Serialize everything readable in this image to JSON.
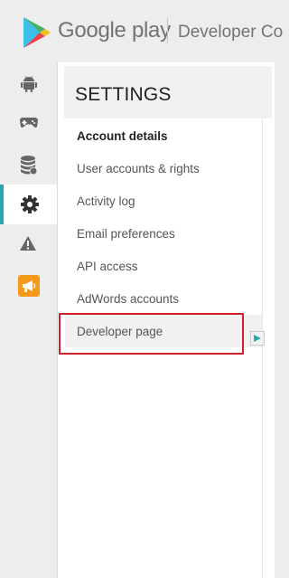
{
  "header": {
    "brand": "Google play",
    "product": "Developer Co"
  },
  "rail": {
    "items": [
      {
        "icon": "android-icon"
      },
      {
        "icon": "gamepad-icon"
      },
      {
        "icon": "database-icon"
      },
      {
        "icon": "gear-icon",
        "active": true
      },
      {
        "icon": "warning-icon"
      },
      {
        "icon": "megaphone-icon"
      }
    ],
    "accent": "#2aa6b0",
    "announce_color": "#f39a1c"
  },
  "settings": {
    "title": "SETTINGS",
    "items": [
      {
        "label": "Account details",
        "selected": true
      },
      {
        "label": "User accounts & rights"
      },
      {
        "label": "Activity log"
      },
      {
        "label": "Email preferences"
      },
      {
        "label": "API access"
      },
      {
        "label": "AdWords accounts"
      },
      {
        "label": "Developer page",
        "hovered": true
      }
    ]
  },
  "highlight_color": "#d0202a"
}
